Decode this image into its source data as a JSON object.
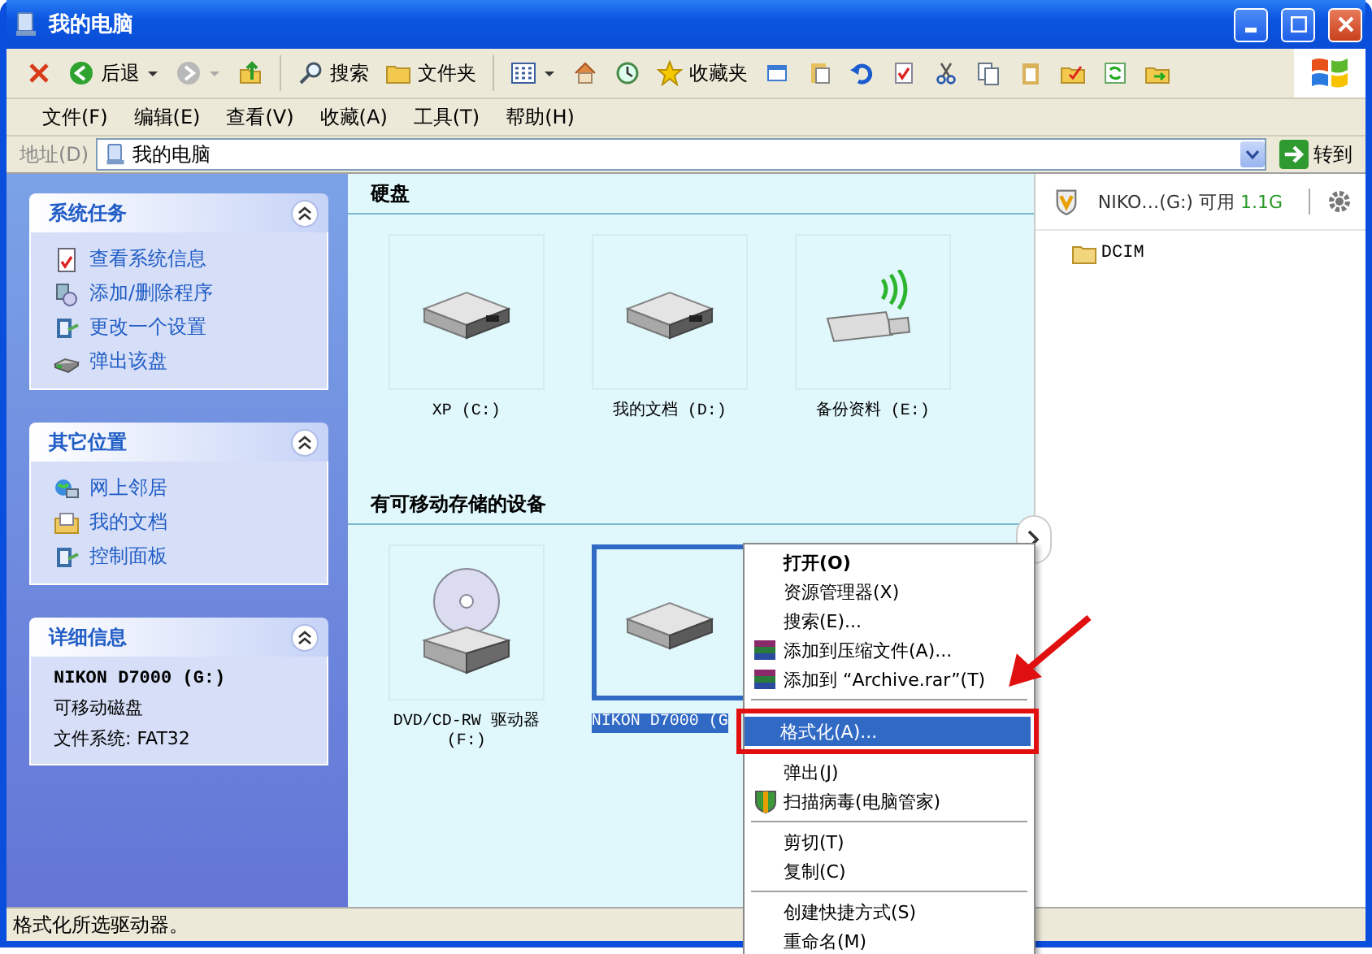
{
  "window": {
    "title": "我的电脑"
  },
  "toolbar": {
    "back": "后退",
    "search": "搜索",
    "folders": "文件夹",
    "favorites": "收藏夹"
  },
  "menu_bar": [
    "文件(F)",
    "编辑(E)",
    "查看(V)",
    "收藏(A)",
    "工具(T)",
    "帮助(H)"
  ],
  "address_bar": {
    "label": "地址(D)",
    "value": "我的电脑",
    "go": "转到"
  },
  "sidebar": {
    "panels": [
      {
        "title": "系统任务",
        "expanded": true,
        "items": [
          "查看系统信息",
          "添加/删除程序",
          "更改一个设置",
          "弹出该盘"
        ]
      },
      {
        "title": "其它位置",
        "expanded": true,
        "items": [
          "网上邻居",
          "我的文档",
          "控制面板"
        ]
      },
      {
        "title": "详细信息",
        "expanded": true,
        "details": {
          "name": "NIKON D7000 (G:)",
          "type": "可移动磁盘",
          "file_system": "文件系统: FAT32"
        }
      }
    ]
  },
  "sections": [
    {
      "title": "硬盘",
      "drives": [
        {
          "label": "XP (C:)",
          "kind": "hard_disk",
          "selected": false
        },
        {
          "label": "我的文档 (D:)",
          "kind": "hard_disk",
          "selected": false
        },
        {
          "label": "备份资料 (E:)",
          "kind": "wireless_usb",
          "selected": false
        }
      ]
    },
    {
      "title": "有可移动存储的设备",
      "drives": [
        {
          "label": "DVD/CD-RW 驱动器 (F:)",
          "kind": "optical",
          "selected": false
        },
        {
          "label": "NIKON D7000 (G",
          "kind": "removable",
          "selected": true
        }
      ]
    }
  ],
  "right_panel": {
    "device": "NIKO…(G:) 可用",
    "free": "1.1G",
    "folders": [
      "DCIM"
    ]
  },
  "context_menu": {
    "items": [
      {
        "kind": "item",
        "label": "打开(O)",
        "default": true,
        "selected": false
      },
      {
        "kind": "item",
        "label": "资源管理器(X)",
        "selected": false
      },
      {
        "kind": "item",
        "label": "搜索(E)...",
        "selected": false
      },
      {
        "kind": "archive",
        "label": "添加到压缩文件(A)...",
        "selected": false
      },
      {
        "kind": "archive",
        "label": "添加到 “Archive.rar”(T)",
        "selected": false
      },
      {
        "kind": "separator"
      },
      {
        "kind": "item",
        "label": "格式化(A)...",
        "selected": true
      },
      {
        "kind": "item",
        "label": "弹出(J)",
        "selected": false
      },
      {
        "kind": "shield",
        "label": "扫描病毒(电脑管家)",
        "selected": false
      },
      {
        "kind": "separator"
      },
      {
        "kind": "item",
        "label": "剪切(T)",
        "selected": false
      },
      {
        "kind": "item",
        "label": "复制(C)",
        "selected": false
      },
      {
        "kind": "separator"
      },
      {
        "kind": "item",
        "label": "创建快捷方式(S)",
        "selected": false
      },
      {
        "kind": "item",
        "label": "重命名(M)",
        "selected": false
      }
    ]
  },
  "status_bar": "格式化所选驱动器。"
}
